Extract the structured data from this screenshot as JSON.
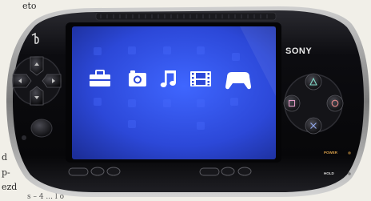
{
  "page_text": {
    "top_left": "eto",
    "left_1": "d",
    "left_2": "p-",
    "left_3": "ezd",
    "bottom": "s – 4 ... l ő"
  },
  "device": {
    "brand": "SONY",
    "power_label": "POWER",
    "hold_label": "HOLD"
  },
  "xmb_icons": [
    "toolbox-icon",
    "camera-icon",
    "music-note-icon",
    "film-icon",
    "gamepad-icon"
  ],
  "colors": {
    "screen_blue": "#2f4fe0",
    "device_body": "#0d0d10",
    "paper": "#f1efe8"
  }
}
